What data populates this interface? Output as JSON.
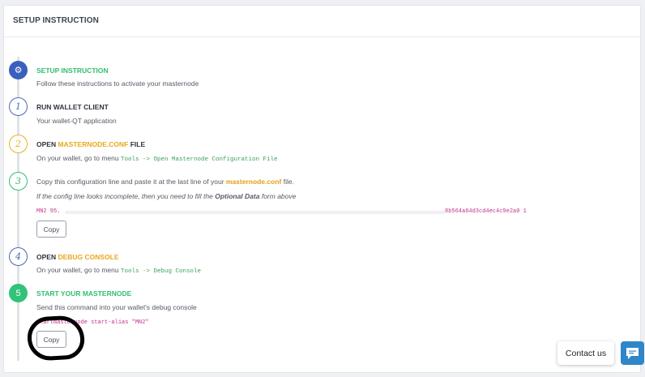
{
  "header": {
    "title": "SETUP INSTRUCTION"
  },
  "steps": {
    "s0": {
      "marker": "⚙",
      "title": "SETUP INSTRUCTION",
      "desc": "Follow these instructions to activate your masternode"
    },
    "s1": {
      "marker": "1",
      "title": "RUN WALLET CLIENT",
      "desc": "Your wallet-QT application"
    },
    "s2": {
      "marker": "2",
      "title_pre": "OPEN ",
      "title_hl": "MASTERNODE.CONF",
      "title_post": " FILE",
      "desc_pre": "On your wallet, go to menu ",
      "desc_code": "Tools -> Open Masternode Configuration File"
    },
    "s3": {
      "marker": "3",
      "desc_pre": "Copy this configuration line and paste it at the last line of your ",
      "desc_hl": "masternode.conf",
      "desc_post": " file.",
      "note_pre": "If the config line looks incomplete, then you need to fill the ",
      "note_bold": "Optional Data",
      "note_post": " form above",
      "code_start": "MN2 95.",
      "code_end": "8b564a64d3cd4ec4c9e2a0 1",
      "copy_label": "Copy"
    },
    "s4": {
      "marker": "4",
      "title_pre": "OPEN ",
      "title_hl": "DEBUG CONSOLE",
      "desc_pre": "On your wallet, go to menu ",
      "desc_code": "Tools -> Debug Console"
    },
    "s5": {
      "marker": "5",
      "title": "START YOUR MASTERNODE",
      "desc": "Send this command into your wallet's debug console",
      "code": "startmasternode start-alias \"MN2\"",
      "copy_label": "Copy"
    }
  },
  "widget": {
    "contact_label": "Contact us",
    "chat_icon": "chat-icon"
  },
  "colors": {
    "accent_green": "#2fbf71",
    "accent_yellow": "#e9b21b",
    "accent_blue": "#4a67b8",
    "code_pink": "#c2338a"
  }
}
